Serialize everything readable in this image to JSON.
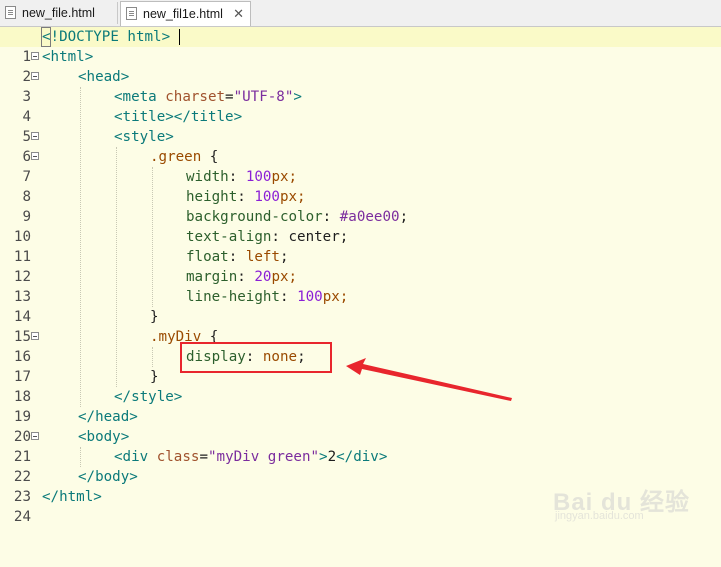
{
  "tabs": [
    {
      "label": "new_file.html",
      "icon": "html-file-icon",
      "active": false
    },
    {
      "label": "new_fil1e.html",
      "icon": "html-file-icon",
      "active": true,
      "close": "✕"
    }
  ],
  "editor": {
    "current_line": 1,
    "lines": [
      {
        "n": "1"
      },
      {
        "n": "2"
      },
      {
        "n": "3"
      },
      {
        "n": "4"
      },
      {
        "n": "5"
      },
      {
        "n": "6"
      },
      {
        "n": "7"
      },
      {
        "n": "8"
      },
      {
        "n": "9"
      },
      {
        "n": "10"
      },
      {
        "n": "11"
      },
      {
        "n": "12"
      },
      {
        "n": "13"
      },
      {
        "n": "14"
      },
      {
        "n": "15"
      },
      {
        "n": "16"
      },
      {
        "n": "17"
      },
      {
        "n": "18"
      },
      {
        "n": "19"
      },
      {
        "n": "20"
      },
      {
        "n": "21"
      },
      {
        "n": "22"
      },
      {
        "n": "23"
      },
      {
        "n": "24"
      }
    ],
    "code": {
      "l1": [
        "<",
        "!DOCTYPE html",
        ">"
      ],
      "l2": [
        "<html>"
      ],
      "l3": [
        "<head>"
      ],
      "l4": [
        "<meta ",
        "charset",
        "=",
        "\"UTF-8\"",
        ">"
      ],
      "l5": [
        "<title></title>"
      ],
      "l6": [
        "<style>"
      ],
      "l7": [
        ".green",
        " {"
      ],
      "l8": [
        "width",
        ": ",
        "100",
        "px;"
      ],
      "l9": [
        "height",
        ": ",
        "100",
        "px;"
      ],
      "l10": [
        "background-color",
        ": ",
        "#a0ee00",
        ";"
      ],
      "l11": [
        "text-align",
        ": ",
        "center",
        ";"
      ],
      "l12": [
        "float",
        ": ",
        "left",
        ";"
      ],
      "l13": [
        "margin",
        ": ",
        "20",
        "px;"
      ],
      "l14": [
        "line-height",
        ": ",
        "100",
        "px;"
      ],
      "l15": [
        "}"
      ],
      "l16": [
        ".myDiv",
        " {"
      ],
      "l17": [
        "display",
        ": ",
        "none",
        ";"
      ],
      "l18": [
        "}"
      ],
      "l19": [
        "</style>"
      ],
      "l20": [
        "</head>"
      ],
      "l21": [
        "<body>"
      ],
      "l22": [
        "<div ",
        "class",
        "=",
        "\"myDiv green\"",
        ">",
        "2",
        "</div>"
      ],
      "l23": [
        "</body>"
      ],
      "l24": [
        "</html>"
      ]
    }
  },
  "watermark": {
    "main": "Bai du 经验",
    "sub": "jingyan.baidu.com"
  },
  "colors": {
    "annotation": "#e8262d",
    "editor_bg": "#fdfde6"
  }
}
